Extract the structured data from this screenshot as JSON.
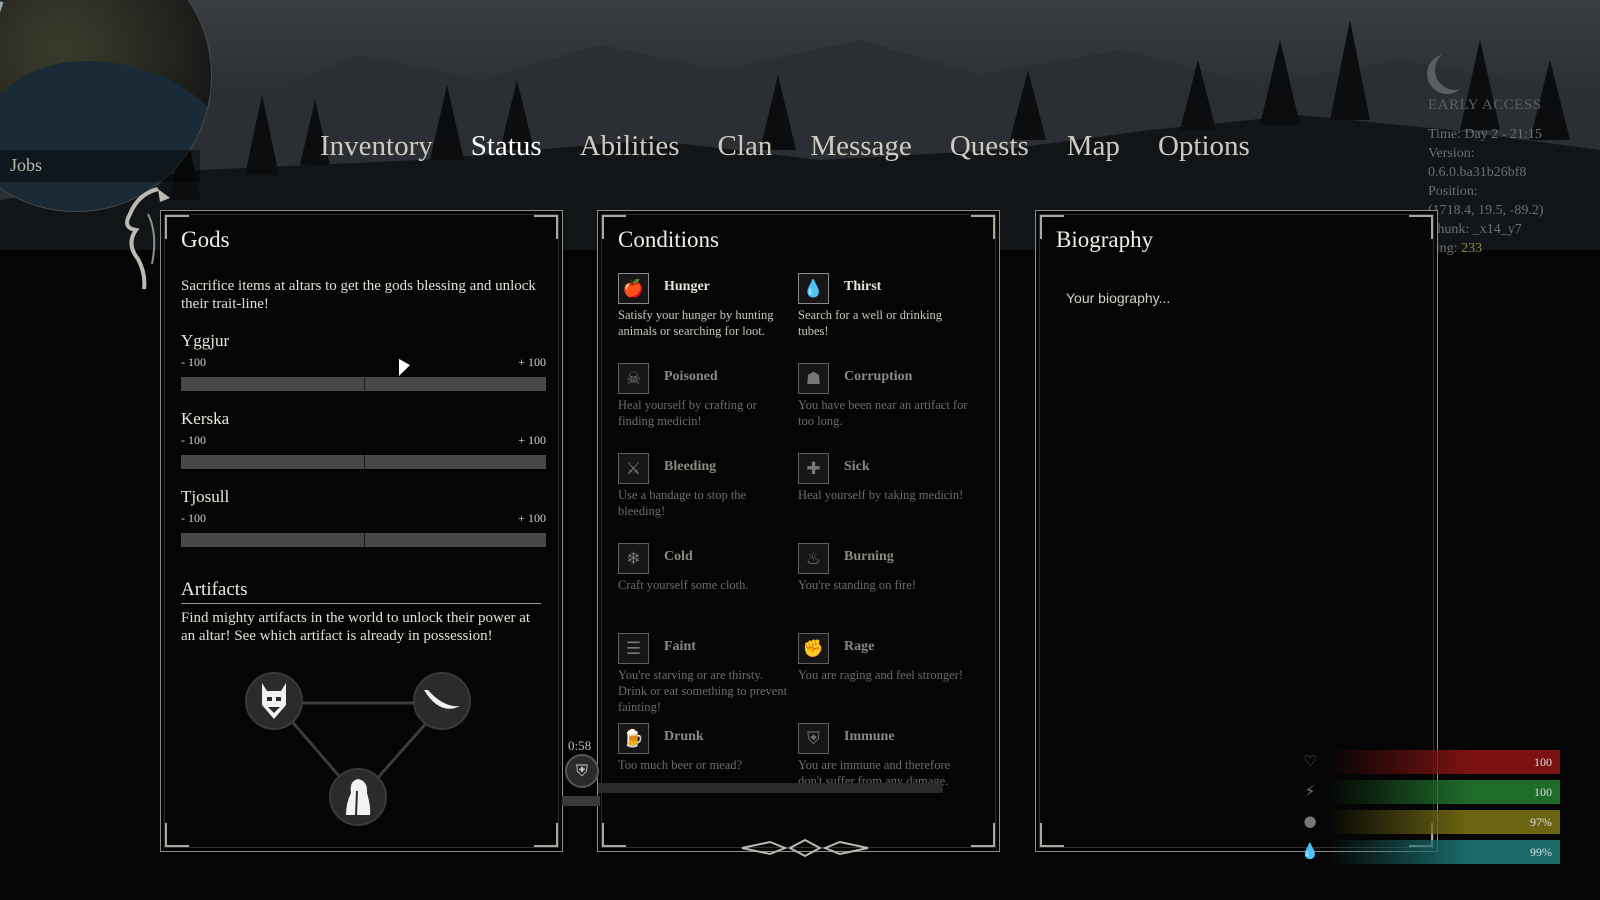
{
  "nav": {
    "tabs": [
      {
        "label": "Inventory",
        "active": false
      },
      {
        "label": "Status",
        "active": true
      },
      {
        "label": "Abilities",
        "active": false
      },
      {
        "label": "Clan",
        "active": false
      },
      {
        "label": "Message",
        "active": false
      },
      {
        "label": "Quests",
        "active": false
      },
      {
        "label": "Map",
        "active": false
      },
      {
        "label": "Options",
        "active": false
      }
    ]
  },
  "minimap": {
    "jobs_label": "Jobs"
  },
  "debug": {
    "early_access": "EARLY ACCESS",
    "time": "Time: Day 2 - 21:15",
    "version_label": "Version:",
    "version": "0.6.0.ba31b26bf8",
    "position_label": "Position:",
    "position": "(1718.4, 19.5, -89.2)",
    "chunk": "Chunk: _x14_y7",
    "ping_label": "Ping:",
    "ping": "233"
  },
  "gods": {
    "title": "Gods",
    "description": "Sacrifice items at altars to get the gods blessing and unlock their trait-line!",
    "list": [
      {
        "name": "Yggjur",
        "min": "- 100",
        "max": "+ 100",
        "value": 0
      },
      {
        "name": "Kerska",
        "min": "- 100",
        "max": "+ 100",
        "value": 0
      },
      {
        "name": "Tjosull",
        "min": "- 100",
        "max": "+ 100",
        "value": 0
      }
    ],
    "artifacts_title": "Artifacts",
    "artifacts_description": "Find mighty artifacts in the world to unlock their power at an altar! See which artifact is already in possession!"
  },
  "conditions": {
    "title": "Conditions",
    "items": [
      {
        "name": "Hunger",
        "desc": "Satisfy your hunger by hunting animals or searching for loot.",
        "active": true,
        "icon": "apple-icon",
        "glyph": "🍎"
      },
      {
        "name": "Thirst",
        "desc": "Search for a well or drinking tubes!",
        "active": true,
        "icon": "water-drop-icon",
        "glyph": "💧"
      },
      {
        "name": "Poisoned",
        "desc": "Heal yourself by crafting or finding medicin!",
        "active": false,
        "icon": "poison-bottle-icon",
        "glyph": "☠"
      },
      {
        "name": "Corruption",
        "desc": "You have been near an artifact for too long.",
        "active": false,
        "icon": "skull-helm-icon",
        "glyph": "☗"
      },
      {
        "name": "Bleeding",
        "desc": "Use a bandage to stop the bleeding!",
        "active": false,
        "icon": "blood-drip-icon",
        "glyph": "⚔"
      },
      {
        "name": "Sick",
        "desc": "Heal yourself by taking medicin!",
        "active": false,
        "icon": "medical-cross-icon",
        "glyph": "✚"
      },
      {
        "name": "Cold",
        "desc": "Craft yourself some cloth.",
        "active": false,
        "icon": "snowflake-icon",
        "glyph": "❄"
      },
      {
        "name": "Burning",
        "desc": "You're standing on fire!",
        "active": false,
        "icon": "flame-icon",
        "glyph": "♨"
      },
      {
        "name": "Faint",
        "desc": "You're starving or are thirsty. Drink or eat something to prevent fainting!",
        "active": false,
        "icon": "faint-icon",
        "glyph": "☰"
      },
      {
        "name": "Rage",
        "desc": "You are raging and feel stronger!",
        "active": false,
        "icon": "muscle-icon",
        "glyph": "✊"
      },
      {
        "name": "Drunk",
        "desc": "Too much beer or mead?",
        "active": false,
        "icon": "mug-icon",
        "glyph": "🍺"
      },
      {
        "name": "Immune",
        "desc": "You are immune and therefore don't suffer from any damage.",
        "active": false,
        "icon": "shield-icon",
        "glyph": "⛨"
      }
    ]
  },
  "biography": {
    "title": "Biography",
    "text": "Your biography..."
  },
  "hud": {
    "timer": "0:58",
    "vitals": [
      {
        "name": "health",
        "value": "100",
        "color": "#7a1212",
        "icon": "heart-icon",
        "glyph": "♡"
      },
      {
        "name": "stamina",
        "value": "100",
        "color": "#1f6b2a",
        "icon": "runner-icon",
        "glyph": "⚡"
      },
      {
        "name": "food",
        "value": "97%",
        "color": "#6b6412",
        "icon": "apple-icon",
        "glyph": "●"
      },
      {
        "name": "water",
        "value": "99%",
        "color": "#1a6a6a",
        "icon": "water-drop-icon",
        "glyph": "💧"
      }
    ]
  }
}
